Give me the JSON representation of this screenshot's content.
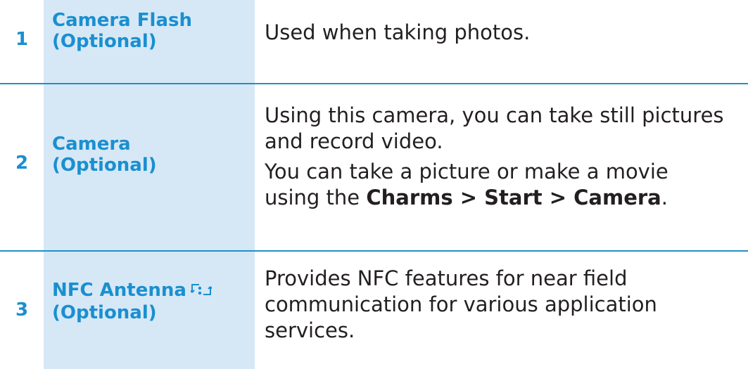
{
  "rows": [
    {
      "number": "1",
      "label_line1": "Camera Flash",
      "label_line2": "(Optional)",
      "description": "Used when taking photos."
    },
    {
      "number": "2",
      "label_line1": "Camera",
      "label_line2": "(Optional)",
      "description_line1": "Using this camera, you can take still pictures",
      "description_line2": "and record video.",
      "description_line3": "You can take a picture or make a movie",
      "description_line4_prefix": "using the ",
      "description_line4_bold": "Charms > Start > Camera",
      "description_line4_suffix": "."
    },
    {
      "number": "3",
      "label_line1": "NFC Antenna",
      "label_icon": "nfc-icon",
      "label_line2": "(Optional)",
      "description_line1": "Provides NFC features for near field",
      "description_line2": "communication for various application",
      "description_line3": "services."
    }
  ],
  "colors": {
    "accent_text": "#1a8fd0",
    "label_background": "#d6e8f6",
    "divider": "#1f8fc8",
    "body_text": "#231f20"
  }
}
